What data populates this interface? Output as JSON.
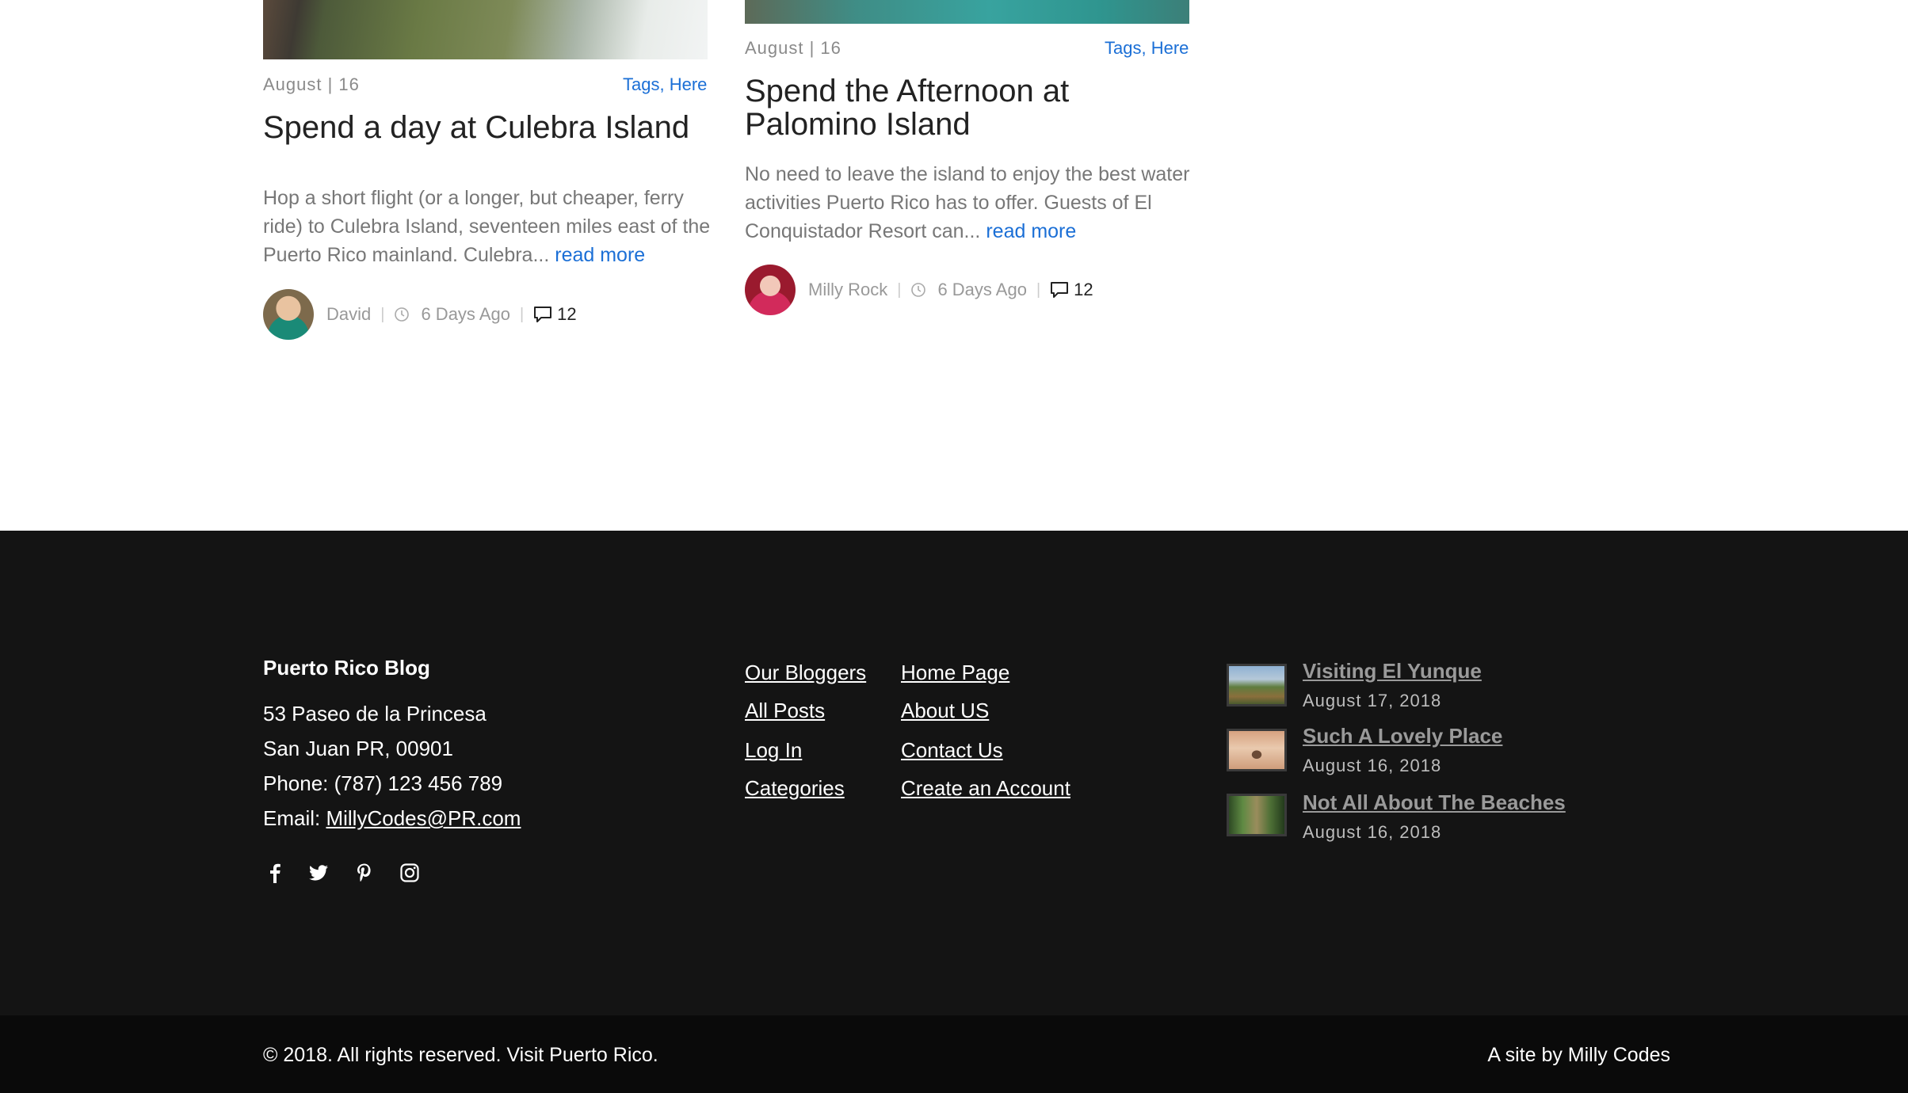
{
  "posts": [
    {
      "date": "August | 16",
      "tags": "Tags, Here",
      "title": "Spend a day at Culebra Island",
      "excerpt": "Hop a short flight (or a longer, but cheaper, ferry ride) to Culebra Island, seventeen miles east of the Puerto Rico mainland. Culebra...",
      "read_more": "read more",
      "author": "David",
      "time_ago": "6 Days Ago",
      "comments": "12"
    },
    {
      "date": "August | 16",
      "tags": "Tags, Here",
      "title_line1": "Spend the Afternoon at",
      "title_line2": "Palomino Island",
      "excerpt": "No need to leave the island to enjoy the best water activities Puerto Rico has to offer. Guests of El Conquistador Resort can...",
      "read_more": "read more",
      "author": "Milly Rock",
      "time_ago": "6 Days Ago",
      "comments": "12"
    }
  ],
  "footer": {
    "about": {
      "title": "Puerto Rico Blog",
      "address1": "53 Paseo de la Princesa",
      "address2": "San Juan PR, 00901",
      "phone": "Phone: (787) 123 456 789",
      "email_label": "Email: ",
      "email": "MillyCodes@PR.com"
    },
    "social_icons": [
      "facebook-icon",
      "twitter-icon",
      "pinterest-icon",
      "instagram-icon"
    ],
    "links_col1": [
      "Our Bloggers",
      "All Posts",
      "Log In",
      "Categories"
    ],
    "links_col2": [
      "Home Page",
      "About US",
      "Contact Us",
      "Create an Account"
    ],
    "recent_posts": [
      {
        "title": "Visiting El Yunque",
        "date": "August 17, 2018"
      },
      {
        "title": "Such A Lovely Place",
        "date": "August 16, 2018"
      },
      {
        "title": "Not All About The Beaches",
        "date": "August 16, 2018"
      }
    ],
    "copyright": "© 2018. All rights reserved. Visit Puerto Rico.",
    "credit": "A site by Milly Codes"
  },
  "colors": {
    "link": "#1b6fd6",
    "footer_bg": "#141414",
    "footer_bottom_bg": "#0a0a0a"
  }
}
